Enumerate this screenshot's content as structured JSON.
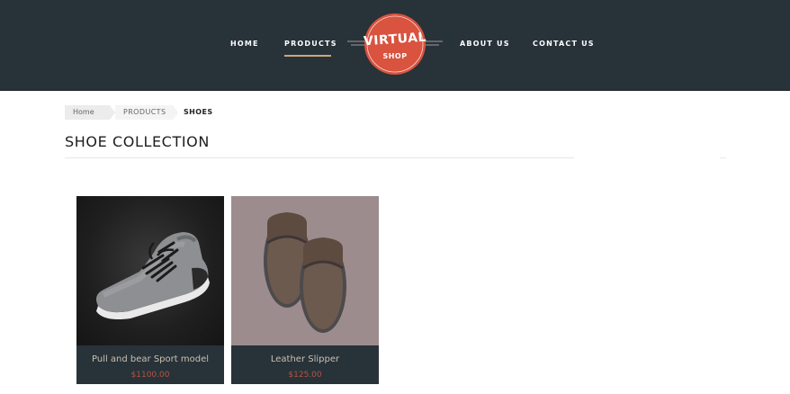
{
  "header": {
    "nav": {
      "home": "HOME",
      "products": "PRODUCTS",
      "about": "ABOUT US",
      "contact": "CONTACT US"
    },
    "active_nav": "PRODUCTS",
    "logo": {
      "line1": "VIRTUAL",
      "line2": "SHOP",
      "circle_color": "#d9533f"
    },
    "background_color": "#283239",
    "underline_color": "#c9a979"
  },
  "breadcrumb": {
    "items": [
      "Home",
      "PRODUCTS"
    ],
    "current": "SHOES"
  },
  "page": {
    "title": "SHOE COLLECTION"
  },
  "products": [
    {
      "name": "Pull and bear Sport model",
      "price": "$1100.00",
      "image_icon": "sneaker-icon"
    },
    {
      "name": "Leather Slipper",
      "price": "$125.00",
      "image_icon": "slippers-icon"
    }
  ],
  "colors": {
    "card_footer": "#283239",
    "product_name": "#c9c0b0",
    "price": "#b5553f"
  }
}
